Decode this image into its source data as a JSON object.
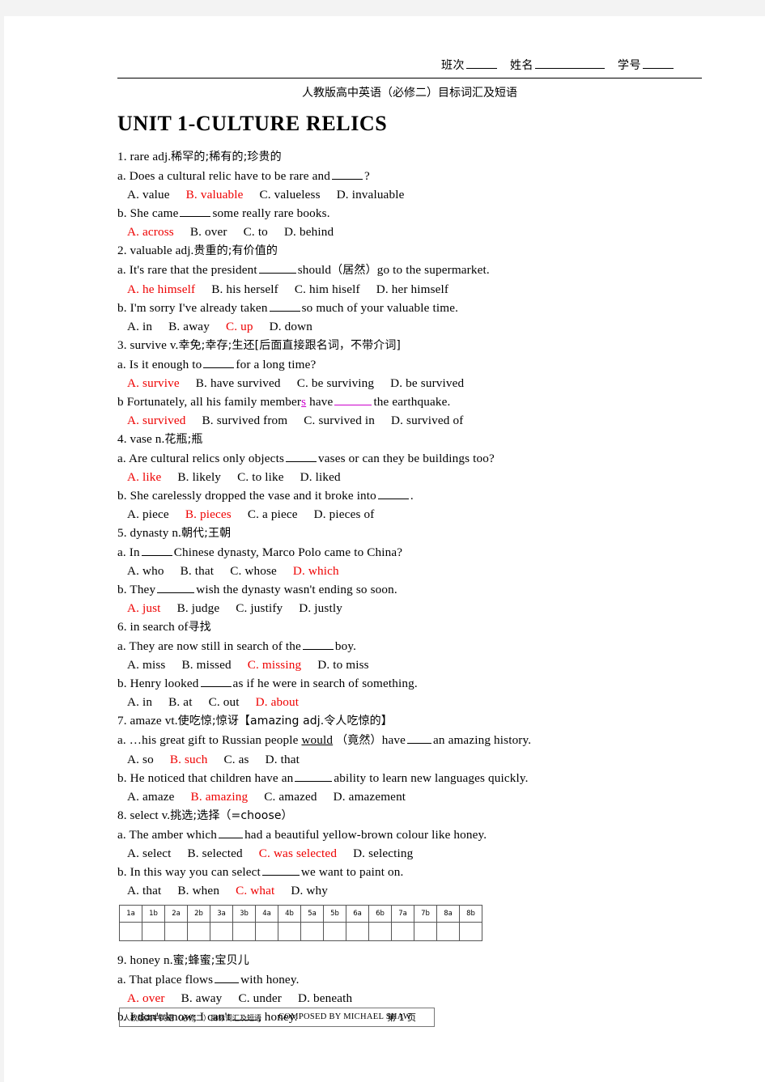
{
  "header": {
    "class_label": "班次",
    "name_label": "姓名",
    "id_label": "学号",
    "subtitle": "人教版高中英语（必修二）目标词汇及短语",
    "title": "UNIT 1-CULTURE RELICS"
  },
  "entries": [
    {
      "n": "1.",
      "word": "rare",
      "pos": "adj.",
      "gloss": "稀罕的;稀有的;珍贵的",
      "questions": [
        {
          "tag": "a.",
          "stem_pre": "Does a cultural relic have to be rare and",
          "blank": 4,
          "stem_post": "?",
          "options": [
            {
              "k": "A.",
              "t": "value",
              "correct": false
            },
            {
              "k": "B.",
              "t": "valuable",
              "correct": true
            },
            {
              "k": "C.",
              "t": "valueless",
              "correct": false
            },
            {
              "k": "D.",
              "t": "invaluable",
              "correct": false
            }
          ]
        },
        {
          "tag": "b.",
          "stem_pre": "She came",
          "blank": 4,
          "stem_post": "some really rare books.",
          "options": [
            {
              "k": "A.",
              "t": "across",
              "correct": true
            },
            {
              "k": "B.",
              "t": "over",
              "correct": false
            },
            {
              "k": "C.",
              "t": "to",
              "correct": false
            },
            {
              "k": "D.",
              "t": "behind",
              "correct": false
            }
          ]
        }
      ]
    },
    {
      "n": "2.",
      "word": "valuable",
      "pos": "adj.",
      "gloss": "贵重的;有价值的",
      "questions": [
        {
          "tag": "a.",
          "stem_pre": "It's rare that the president",
          "blank": 5,
          "stem_post": "should（居然）go to the supermarket.",
          "options": [
            {
              "k": "A.",
              "t": "he himself",
              "correct": true
            },
            {
              "k": "B.",
              "t": "his herself",
              "correct": false
            },
            {
              "k": "C.",
              "t": "him hiself",
              "correct": false
            },
            {
              "k": "D.",
              "t": "her himself",
              "correct": false
            }
          ]
        },
        {
          "tag": "b.",
          "stem_pre": "I'm sorry I've already taken",
          "blank": 4,
          "stem_post": "so much of your valuable time.",
          "options": [
            {
              "k": "A.",
              "t": "in",
              "correct": false
            },
            {
              "k": "B.",
              "t": "away",
              "correct": false
            },
            {
              "k": "C.",
              "t": "up",
              "correct": true
            },
            {
              "k": "D.",
              "t": "down",
              "correct": false
            }
          ]
        }
      ]
    },
    {
      "n": "3.",
      "word": "survive",
      "pos": "v.",
      "gloss": "幸免;幸存;生还[后面直接跟名词，不带介词]",
      "questions": [
        {
          "tag": "a.",
          "stem_pre": "Is it enough to",
          "blank": 4,
          "stem_post": "for a long time?",
          "options": [
            {
              "k": "A.",
              "t": "survive",
              "correct": true
            },
            {
              "k": "B.",
              "t": "have survived",
              "correct": false
            },
            {
              "k": "C.",
              "t": "be surviving",
              "correct": false
            },
            {
              "k": "D.",
              "t": "be survived",
              "correct": false
            }
          ]
        },
        {
          "tag": "b",
          "stem_pre": "Fortunately, all his family member",
          "mag_char": "s",
          "stem_mid": "have",
          "blank": 5,
          "blank_magenta": true,
          "stem_post": "the earthquake.",
          "options": [
            {
              "k": "A.",
              "t": "survived",
              "correct": true
            },
            {
              "k": "B.",
              "t": "survived from",
              "correct": false
            },
            {
              "k": "C.",
              "t": "survived in",
              "correct": false
            },
            {
              "k": "D.",
              "t": "survived of",
              "correct": false
            }
          ]
        }
      ]
    },
    {
      "n": "4.",
      "word": "vase",
      "pos": "n.",
      "gloss": "花瓶;瓶",
      "questions": [
        {
          "tag": "a.",
          "stem_pre": "Are cultural relics only objects",
          "blank": 4,
          "stem_post": "vases or can they be buildings too?",
          "options": [
            {
              "k": "A.",
              "t": "like",
              "correct": true
            },
            {
              "k": "B.",
              "t": "likely",
              "correct": false
            },
            {
              "k": "C.",
              "t": "to like",
              "correct": false
            },
            {
              "k": "D.",
              "t": "liked",
              "correct": false
            }
          ]
        },
        {
          "tag": "b.",
          "stem_pre": "She carelessly dropped the vase and it broke into",
          "blank": 4,
          "stem_post": ".",
          "options": [
            {
              "k": "A.",
              "t": "piece",
              "correct": false
            },
            {
              "k": "B.",
              "t": "pieces",
              "correct": true
            },
            {
              "k": "C.",
              "t": "a piece",
              "correct": false
            },
            {
              "k": "D.",
              "t": "pieces of",
              "correct": false
            }
          ]
        }
      ]
    },
    {
      "n": "5.",
      "word": "dynasty",
      "pos": "n.",
      "gloss": "朝代;王朝",
      "questions": [
        {
          "tag": "a.",
          "stem_pre": "In",
          "blank": 4,
          "stem_post": "Chinese dynasty, Marco Polo came to China?",
          "options": [
            {
              "k": "A.",
              "t": "who",
              "correct": false
            },
            {
              "k": "B.",
              "t": "that",
              "correct": false
            },
            {
              "k": "C.",
              "t": "whose",
              "correct": false
            },
            {
              "k": "D.",
              "t": "which",
              "correct": true
            }
          ]
        },
        {
          "tag": "b.",
          "stem_pre": "They",
          "blank": 5,
          "stem_post": "wish the dynasty wasn't ending so soon.",
          "options": [
            {
              "k": "A.",
              "t": "just",
              "correct": true
            },
            {
              "k": "B.",
              "t": "judge",
              "correct": false
            },
            {
              "k": "C.",
              "t": "justify",
              "correct": false
            },
            {
              "k": "D.",
              "t": "justly",
              "correct": false
            }
          ]
        }
      ]
    },
    {
      "n": "6.",
      "word": "in search of",
      "pos": "",
      "gloss": "寻找",
      "questions": [
        {
          "tag": "a.",
          "stem_pre": "They are now still in search of the",
          "blank": 4,
          "stem_post": "boy.",
          "options": [
            {
              "k": "A.",
              "t": "miss",
              "correct": false
            },
            {
              "k": "B.",
              "t": "missed",
              "correct": false
            },
            {
              "k": "C.",
              "t": "missing",
              "correct": true
            },
            {
              "k": "D.",
              "t": "to miss",
              "correct": false
            }
          ]
        },
        {
          "tag": "b.",
          "stem_pre": "Henry looked",
          "blank": 4,
          "stem_post": "as if he were in search of something.",
          "options": [
            {
              "k": "A.",
              "t": "in",
              "correct": false
            },
            {
              "k": "B.",
              "t": "at",
              "correct": false
            },
            {
              "k": "C.",
              "t": "out",
              "correct": false
            },
            {
              "k": "D.",
              "t": "about",
              "correct": true
            }
          ]
        }
      ]
    },
    {
      "n": "7.",
      "word": "amaze",
      "pos": "vt.",
      "gloss": "使吃惊;惊讶【amazing adj.令人吃惊的】",
      "questions": [
        {
          "tag": "a.",
          "stem_pre": "…his great gift to Russian people",
          "underlined": "would",
          "stem_mid": "（竟然）have",
          "blank": 3,
          "stem_post": "an amazing history.",
          "options": [
            {
              "k": "A.",
              "t": "so",
              "correct": false
            },
            {
              "k": "B.",
              "t": "such",
              "correct": true
            },
            {
              "k": "C.",
              "t": "as",
              "correct": false
            },
            {
              "k": "D.",
              "t": "that",
              "correct": false
            }
          ]
        },
        {
          "tag": "b.",
          "stem_pre": "He noticed that children have an",
          "blank": 5,
          "stem_post": "ability to learn new languages quickly.",
          "options": [
            {
              "k": "A.",
              "t": "amaze",
              "correct": false
            },
            {
              "k": "B.",
              "t": "amazing",
              "correct": true
            },
            {
              "k": "C.",
              "t": "amazed",
              "correct": false
            },
            {
              "k": "D.",
              "t": "amazement",
              "correct": false
            }
          ]
        }
      ]
    },
    {
      "n": "8.",
      "word": "select",
      "pos": "v.",
      "gloss": "挑选;选择（=choose）",
      "questions": [
        {
          "tag": "a.",
          "stem_pre": "The amber which",
          "blank": 3,
          "stem_post": "had a beautiful yellow-brown colour like honey.",
          "options": [
            {
              "k": "A.",
              "t": "select",
              "correct": false
            },
            {
              "k": "B.",
              "t": "selected",
              "correct": false
            },
            {
              "k": "C.",
              "t": "was selected",
              "correct": true
            },
            {
              "k": "D.",
              "t": "selecting",
              "correct": false
            }
          ]
        },
        {
          "tag": "b.",
          "stem_pre": "In this way you can select",
          "blank": 5,
          "stem_post": "we want to paint on.",
          "options": [
            {
              "k": "A.",
              "t": "that",
              "correct": false
            },
            {
              "k": "B.",
              "t": "when",
              "correct": false
            },
            {
              "k": "C.",
              "t": "what",
              "correct": true
            },
            {
              "k": "D.",
              "t": "why",
              "correct": false
            }
          ]
        }
      ]
    }
  ],
  "answer_grid": {
    "headers": [
      "1a",
      "1b",
      "2a",
      "2b",
      "3a",
      "3b",
      "4a",
      "4b",
      "5a",
      "5b",
      "6a",
      "6b",
      "7a",
      "7b",
      "8a",
      "8b"
    ],
    "answers": [
      "",
      "",
      "",
      "",
      "",
      "",
      "",
      "",
      "",
      "",
      "",
      "",
      "",
      "",
      "",
      ""
    ]
  },
  "entries_after_grid": [
    {
      "n": "9.",
      "word": "honey",
      "pos": "n.",
      "gloss": "蜜;蜂蜜;宝贝儿",
      "questions": [
        {
          "tag": "a.",
          "stem_pre": "That place flows",
          "blank": 3,
          "stem_post": "with honey.",
          "options": [
            {
              "k": "A.",
              "t": "over",
              "correct": true
            },
            {
              "k": "B.",
              "t": "away",
              "correct": false
            },
            {
              "k": "C.",
              "t": "under",
              "correct": false
            },
            {
              "k": "D.",
              "t": "beneath",
              "correct": false
            }
          ]
        },
        {
          "tag": "b.",
          "stem_pre": "I don't know; I can't",
          "blank": 3,
          "stem_post": ", honey.",
          "options": []
        }
      ]
    }
  ],
  "footer": {
    "left": "人教版高中英语（必修二）目标词汇及短语",
    "center": "COMPOSED BY MICHAEL SHAW",
    "page": "第 1 页"
  },
  "colors": {
    "answer_red": "#ee0000",
    "highlight_magenta": "#cc00cc",
    "page_background": "#ffffff",
    "canvas_background": "#f3f3f3"
  }
}
